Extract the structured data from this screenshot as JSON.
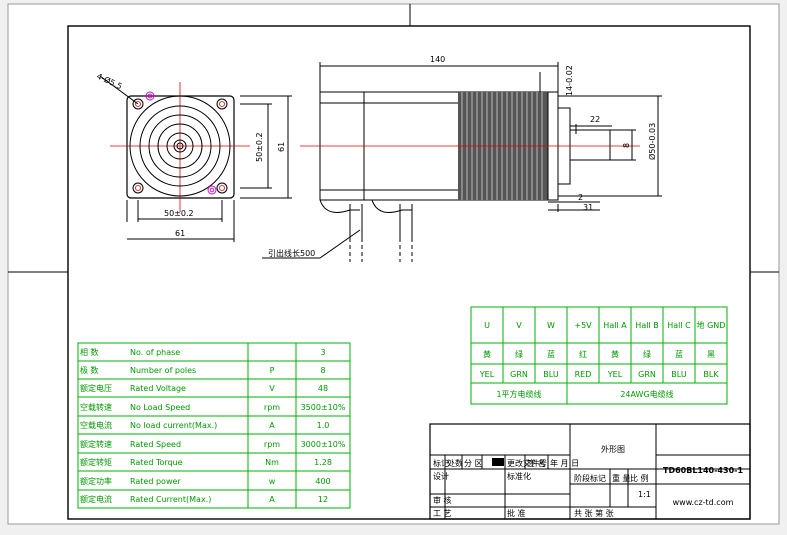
{
  "drawing": {
    "dimensions": {
      "holes": "4-Ø5.5",
      "bolt_pitch_v": "50±0.2",
      "flange_v": "61",
      "bolt_pitch_h": "50±0.2",
      "flange_h": "61",
      "length": "140",
      "flange_thk": "14-0.02",
      "shaft_len": "22",
      "boss_dia": "Ø50-0.03",
      "shaft_dia": "8",
      "boss_h": "2",
      "boss_len": "31",
      "lead_wire": "引出线长500"
    }
  },
  "wiring": {
    "headers": [
      "U",
      "V",
      "W",
      "+5V",
      "Hall A",
      "Hall B",
      "Hall C",
      "地 GND"
    ],
    "colors_cn": [
      "黄",
      "绿",
      "蓝",
      "红",
      "黄",
      "绿",
      "蓝",
      "黑"
    ],
    "colors_en": [
      "YEL",
      "GRN",
      "BLU",
      "RED",
      "YEL",
      "GRN",
      "BLU",
      "BLK"
    ],
    "footer_left": "1平方电缆线",
    "footer_right": "24AWG电缆线"
  },
  "specs": [
    {
      "cn": "相  数",
      "en": "No. of phase",
      "unit": "",
      "value": "3"
    },
    {
      "cn": "极  数",
      "en": "Number of poles",
      "unit": "P",
      "value": "8"
    },
    {
      "cn": "额定电压",
      "en": "Rated Voltage",
      "unit": "V",
      "value": "48"
    },
    {
      "cn": "空载转速",
      "en": "No Load Speed",
      "unit": "rpm",
      "value": "3500±10%"
    },
    {
      "cn": "空载电流",
      "en": "No load current(Max.)",
      "unit": "A",
      "value": "1.0"
    },
    {
      "cn": "额定转速",
      "en": "Rated Speed",
      "unit": "rpm",
      "value": "3000±10%"
    },
    {
      "cn": "额定转矩",
      "en": "Rated Torque",
      "unit": "Nm",
      "value": "1.28"
    },
    {
      "cn": "额定功率",
      "en": "Rated power",
      "unit": "w",
      "value": "400"
    },
    {
      "cn": "额定电流",
      "en": "Rated Current(Max.)",
      "unit": "A",
      "value": "12"
    }
  ],
  "titleblock": {
    "drawing_name": "外形图",
    "model": "TD60BL140-430-1",
    "website": "www.cz-td.com",
    "scale": "1:1",
    "row_labels": [
      "标记",
      "处数",
      "分 区",
      "更改文件号",
      "签 名",
      "年 月 日"
    ],
    "design": "设计",
    "std": "标准化",
    "check": "审 核",
    "process": "工 艺",
    "approve": "批 准",
    "stage": "阶段标记",
    "weight": "重 量",
    "ratio": "比 例",
    "total": "共  张 第 张"
  }
}
